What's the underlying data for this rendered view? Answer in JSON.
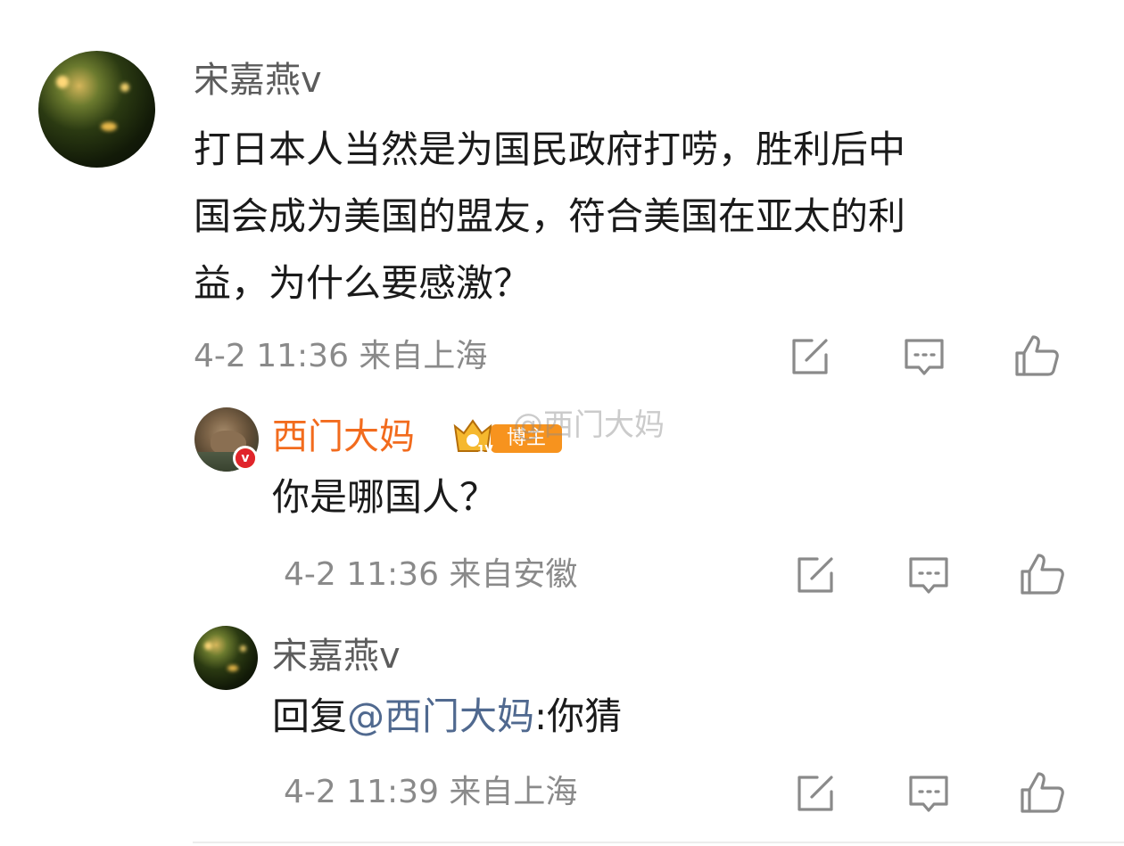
{
  "main_comment": {
    "username": "宋嘉燕v",
    "content_lines": [
      "打日本人当然是为国民政府打唠，胜利后中",
      "国会成为美国的盟友，符合美国在亚太的利",
      "益，为什么要感激？"
    ],
    "meta": "4-2 11:36 来自上海",
    "avatar_icon": "night-garden-avatar"
  },
  "replies": [
    {
      "username": "西门大妈",
      "badge_label": "博主",
      "watermark": "@西门大妈",
      "content": "你是哪国人？",
      "meta": "4-2 11:36 来自安徽",
      "avatar_icon": "capybara-avatar",
      "verified_badge": "v"
    },
    {
      "username": "宋嘉燕v",
      "reply_prefix": "回复",
      "mention": "@西门大妈",
      "reply_suffix": ":你猜",
      "meta": "4-2 11:39 来自上海",
      "avatar_icon": "night-garden-avatar"
    }
  ],
  "actions": {
    "share_icon": "share-edit-icon",
    "comment_icon": "comment-icon",
    "like_icon": "thumbs-up-icon"
  },
  "colors": {
    "username_gray": "#5c5c5c",
    "username_orange": "#f26b1d",
    "mention_blue": "#50698f",
    "meta_gray": "#8a8a8a",
    "icon_gray": "#8a8a8a"
  }
}
